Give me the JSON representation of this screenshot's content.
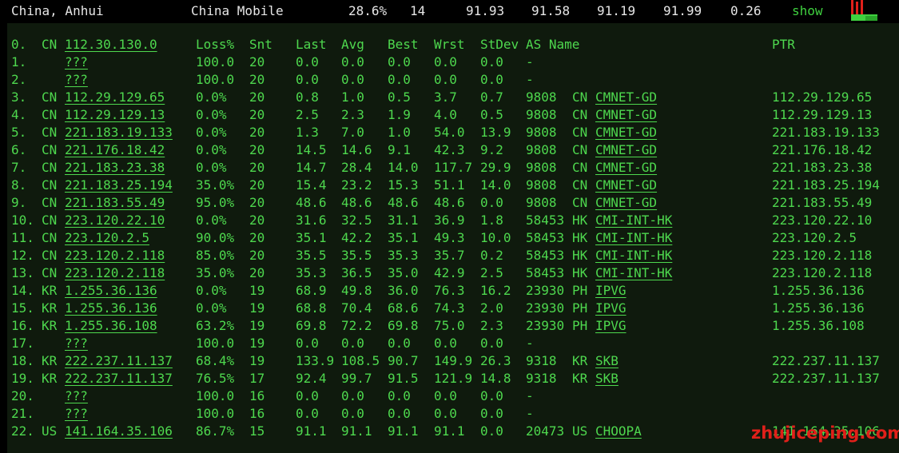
{
  "top": {
    "location": "China, Anhui",
    "isp": "China Mobile",
    "loss": "28.6%",
    "sent": "14",
    "last": "91.93",
    "avg": "91.58",
    "best": "91.19",
    "worst": "91.99",
    "stdev": "0.26",
    "show_label": "show"
  },
  "colors": {
    "text": "#4ed84e",
    "panel_bg": "#0f1a0d",
    "watermark": "#e0201a",
    "spark_red": "#e0201a",
    "spark_green": "#3fd13f"
  },
  "headers": {
    "hop": "0.",
    "cc": "CN",
    "host": "112.30.130.0",
    "loss": "Loss%",
    "snt": "Snt",
    "last": "Last",
    "avg": "Avg",
    "best": "Best",
    "wrst": "Wrst",
    "stdev": "StDev",
    "asname": "AS Name",
    "ptr": "PTR"
  },
  "rows": [
    {
      "hop": "1.",
      "cc": "",
      "host": "???",
      "loss": "100.0",
      "snt": "20",
      "last": "0.0",
      "avg": "0.0",
      "best": "0.0",
      "wrst": "0.0",
      "stdev": "0.0",
      "asn": "-",
      "ascc": "",
      "asname": "",
      "ptr": ""
    },
    {
      "hop": "2.",
      "cc": "",
      "host": "???",
      "loss": "100.0",
      "snt": "20",
      "last": "0.0",
      "avg": "0.0",
      "best": "0.0",
      "wrst": "0.0",
      "stdev": "0.0",
      "asn": "-",
      "ascc": "",
      "asname": "",
      "ptr": ""
    },
    {
      "hop": "3.",
      "cc": "CN",
      "host": "112.29.129.65",
      "loss": "0.0%",
      "snt": "20",
      "last": "0.8",
      "avg": "1.0",
      "best": "0.5",
      "wrst": "3.7",
      "stdev": "0.7",
      "asn": "9808",
      "ascc": "CN",
      "asname": "CMNET-GD",
      "ptr": "112.29.129.65"
    },
    {
      "hop": "4.",
      "cc": "CN",
      "host": "112.29.129.13",
      "loss": "0.0%",
      "snt": "20",
      "last": "2.5",
      "avg": "2.3",
      "best": "1.9",
      "wrst": "4.0",
      "stdev": "0.5",
      "asn": "9808",
      "ascc": "CN",
      "asname": "CMNET-GD",
      "ptr": "112.29.129.13"
    },
    {
      "hop": "5.",
      "cc": "CN",
      "host": "221.183.19.133",
      "loss": "0.0%",
      "snt": "20",
      "last": "1.3",
      "avg": "7.0",
      "best": "1.0",
      "wrst": "54.0",
      "stdev": "13.9",
      "asn": "9808",
      "ascc": "CN",
      "asname": "CMNET-GD",
      "ptr": "221.183.19.133"
    },
    {
      "hop": "6.",
      "cc": "CN",
      "host": "221.176.18.42",
      "loss": "0.0%",
      "snt": "20",
      "last": "14.5",
      "avg": "14.6",
      "best": "9.1",
      "wrst": "42.3",
      "stdev": "9.2",
      "asn": "9808",
      "ascc": "CN",
      "asname": "CMNET-GD",
      "ptr": "221.176.18.42"
    },
    {
      "hop": "7.",
      "cc": "CN",
      "host": "221.183.23.38",
      "loss": "0.0%",
      "snt": "20",
      "last": "14.7",
      "avg": "28.4",
      "best": "14.0",
      "wrst": "117.7",
      "stdev": "29.9",
      "asn": "9808",
      "ascc": "CN",
      "asname": "CMNET-GD",
      "ptr": "221.183.23.38"
    },
    {
      "hop": "8.",
      "cc": "CN",
      "host": "221.183.25.194",
      "loss": "35.0%",
      "snt": "20",
      "last": "15.4",
      "avg": "23.2",
      "best": "15.3",
      "wrst": "51.1",
      "stdev": "14.0",
      "asn": "9808",
      "ascc": "CN",
      "asname": "CMNET-GD",
      "ptr": "221.183.25.194"
    },
    {
      "hop": "9.",
      "cc": "CN",
      "host": "221.183.55.49",
      "loss": "95.0%",
      "snt": "20",
      "last": "48.6",
      "avg": "48.6",
      "best": "48.6",
      "wrst": "48.6",
      "stdev": "0.0",
      "asn": "9808",
      "ascc": "CN",
      "asname": "CMNET-GD",
      "ptr": "221.183.55.49"
    },
    {
      "hop": "10.",
      "cc": "CN",
      "host": "223.120.22.10",
      "loss": "0.0%",
      "snt": "20",
      "last": "31.6",
      "avg": "32.5",
      "best": "31.1",
      "wrst": "36.9",
      "stdev": "1.8",
      "asn": "58453",
      "ascc": "HK",
      "asname": "CMI-INT-HK",
      "ptr": "223.120.22.10"
    },
    {
      "hop": "11.",
      "cc": "CN",
      "host": "223.120.2.5",
      "loss": "90.0%",
      "snt": "20",
      "last": "35.1",
      "avg": "42.2",
      "best": "35.1",
      "wrst": "49.3",
      "stdev": "10.0",
      "asn": "58453",
      "ascc": "HK",
      "asname": "CMI-INT-HK",
      "ptr": "223.120.2.5"
    },
    {
      "hop": "12.",
      "cc": "CN",
      "host": "223.120.2.118",
      "loss": "85.0%",
      "snt": "20",
      "last": "35.5",
      "avg": "35.5",
      "best": "35.3",
      "wrst": "35.7",
      "stdev": "0.2",
      "asn": "58453",
      "ascc": "HK",
      "asname": "CMI-INT-HK",
      "ptr": "223.120.2.118"
    },
    {
      "hop": "13.",
      "cc": "CN",
      "host": "223.120.2.118",
      "loss": "35.0%",
      "snt": "20",
      "last": "35.3",
      "avg": "36.5",
      "best": "35.0",
      "wrst": "42.9",
      "stdev": "2.5",
      "asn": "58453",
      "ascc": "HK",
      "asname": "CMI-INT-HK",
      "ptr": "223.120.2.118"
    },
    {
      "hop": "14.",
      "cc": "KR",
      "host": "1.255.36.136",
      "loss": "0.0%",
      "snt": "19",
      "last": "68.9",
      "avg": "49.8",
      "best": "36.0",
      "wrst": "76.3",
      "stdev": "16.2",
      "asn": "23930",
      "ascc": "PH",
      "asname": "IPVG",
      "ptr": "1.255.36.136"
    },
    {
      "hop": "15.",
      "cc": "KR",
      "host": "1.255.36.136",
      "loss": "0.0%",
      "snt": "19",
      "last": "68.8",
      "avg": "70.4",
      "best": "68.6",
      "wrst": "74.3",
      "stdev": "2.0",
      "asn": "23930",
      "ascc": "PH",
      "asname": "IPVG",
      "ptr": "1.255.36.136"
    },
    {
      "hop": "16.",
      "cc": "KR",
      "host": "1.255.36.108",
      "loss": "63.2%",
      "snt": "19",
      "last": "69.8",
      "avg": "72.2",
      "best": "69.8",
      "wrst": "75.0",
      "stdev": "2.3",
      "asn": "23930",
      "ascc": "PH",
      "asname": "IPVG",
      "ptr": "1.255.36.108"
    },
    {
      "hop": "17.",
      "cc": "",
      "host": "???",
      "loss": "100.0",
      "snt": "19",
      "last": "0.0",
      "avg": "0.0",
      "best": "0.0",
      "wrst": "0.0",
      "stdev": "0.0",
      "asn": "-",
      "ascc": "",
      "asname": "",
      "ptr": ""
    },
    {
      "hop": "18.",
      "cc": "KR",
      "host": "222.237.11.137",
      "loss": "68.4%",
      "snt": "19",
      "last": "133.9",
      "avg": "108.5",
      "best": "90.7",
      "wrst": "149.9",
      "stdev": "26.3",
      "asn": "9318",
      "ascc": "KR",
      "asname": "SKB",
      "ptr": "222.237.11.137"
    },
    {
      "hop": "19.",
      "cc": "KR",
      "host": "222.237.11.137",
      "loss": "76.5%",
      "snt": "17",
      "last": "92.4",
      "avg": "99.7",
      "best": "91.5",
      "wrst": "121.9",
      "stdev": "14.8",
      "asn": "9318",
      "ascc": "KR",
      "asname": "SKB",
      "ptr": "222.237.11.137"
    },
    {
      "hop": "20.",
      "cc": "",
      "host": "???",
      "loss": "100.0",
      "snt": "16",
      "last": "0.0",
      "avg": "0.0",
      "best": "0.0",
      "wrst": "0.0",
      "stdev": "0.0",
      "asn": "-",
      "ascc": "",
      "asname": "",
      "ptr": ""
    },
    {
      "hop": "21.",
      "cc": "",
      "host": "???",
      "loss": "100.0",
      "snt": "16",
      "last": "0.0",
      "avg": "0.0",
      "best": "0.0",
      "wrst": "0.0",
      "stdev": "0.0",
      "asn": "-",
      "ascc": "",
      "asname": "",
      "ptr": ""
    },
    {
      "hop": "22.",
      "cc": "US",
      "host": "141.164.35.106",
      "loss": "86.7%",
      "snt": "15",
      "last": "91.1",
      "avg": "91.1",
      "best": "91.1",
      "wrst": "91.1",
      "stdev": "0.0",
      "asn": "20473",
      "ascc": "US",
      "asname": "CHOOPA",
      "ptr": "141.164.35.106"
    }
  ],
  "watermark": "zhujiceping.com"
}
